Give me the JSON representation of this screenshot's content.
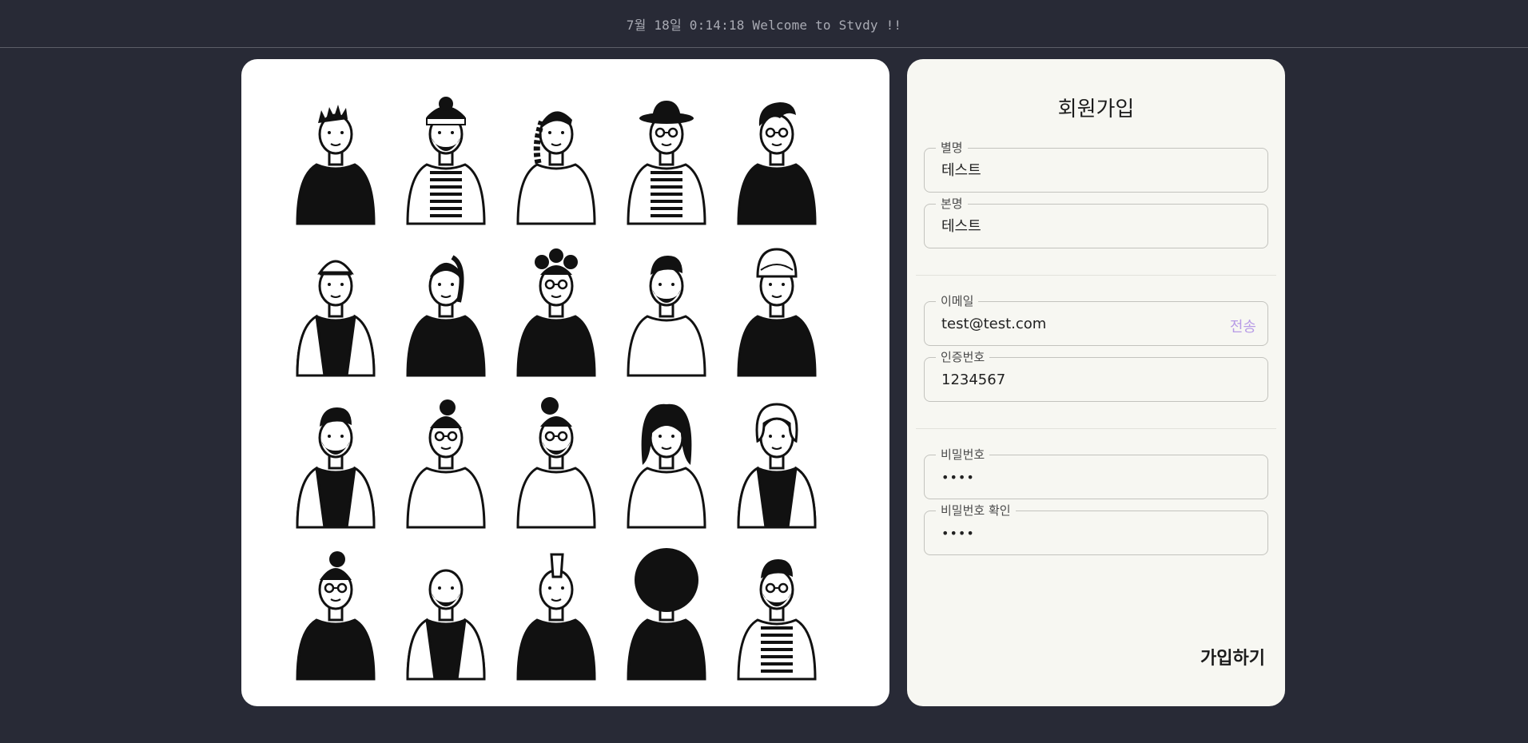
{
  "header": {
    "ticker": "7월 18일 0:14:18 Welcome to Stvdy !!"
  },
  "gallery": {
    "people": [
      {
        "name": "person-spiky-hair-pocket-tee",
        "dark_shirt": true,
        "hair": "spiky"
      },
      {
        "name": "person-bandana-beard-striped",
        "dark_shirt": false,
        "hair": "bandana",
        "beard": true,
        "stripes": true
      },
      {
        "name": "person-braid-tee",
        "dark_shirt": false,
        "hair": "braid"
      },
      {
        "name": "person-hat-glasses-blazer",
        "dark_shirt": false,
        "hair": "hat",
        "glasses": true,
        "stripes": true
      },
      {
        "name": "person-quiff-pocket-tee",
        "dark_shirt": true,
        "hair": "quiff",
        "glasses": true
      },
      {
        "name": "person-beanie-blazer",
        "dark_shirt": true,
        "hair": "beanie",
        "jacket": true
      },
      {
        "name": "person-ponytail-dark-tee",
        "dark_shirt": true,
        "hair": "ponytail"
      },
      {
        "name": "person-buns-glasses-arms-crossed",
        "dark_shirt": true,
        "hair": "buns",
        "glasses": true
      },
      {
        "name": "person-beard-coffee-cup",
        "dark_shirt": false,
        "hair": "short",
        "beard": true
      },
      {
        "name": "person-turban-dotted-sweater",
        "dark_shirt": true,
        "hair": "turban"
      },
      {
        "name": "person-beard-puffer-jacket",
        "dark_shirt": true,
        "hair": "short",
        "beard": true,
        "jacket": true
      },
      {
        "name": "person-sunglasses-gamepad-hoodie",
        "dark_shirt": false,
        "hair": "bun",
        "glasses": true
      },
      {
        "name": "person-topknot-glasses-beard",
        "dark_shirt": false,
        "hair": "topknot",
        "glasses": true,
        "beard": true
      },
      {
        "name": "person-long-hair-shirt",
        "dark_shirt": false,
        "hair": "long"
      },
      {
        "name": "person-curly-mustache-cardigan",
        "dark_shirt": true,
        "hair": "curly",
        "jacket": true
      },
      {
        "name": "person-bun-monocle-pointing",
        "dark_shirt": true,
        "hair": "bun",
        "glasses": true
      },
      {
        "name": "person-bald-beard-dotted-jacket",
        "dark_shirt": true,
        "hair": "bald",
        "beard": true,
        "jacket": true
      },
      {
        "name": "person-mohawk-tee",
        "dark_shirt": true,
        "hair": "mohawk"
      },
      {
        "name": "person-afro-glasses-pointing",
        "dark_shirt": true,
        "hair": "afro",
        "glasses": true
      },
      {
        "name": "person-glasses-beard-blazer",
        "dark_shirt": false,
        "hair": "short",
        "glasses": true,
        "beard": true,
        "stripes": true
      }
    ]
  },
  "signup": {
    "title": "회원가입",
    "nickname": {
      "label": "별명",
      "value": "테스트"
    },
    "realname": {
      "label": "본명",
      "value": "테스트"
    },
    "email": {
      "label": "이메일",
      "value": "test@test.com",
      "send_label": "전송"
    },
    "code": {
      "label": "인증번호",
      "value": "1234567"
    },
    "password": {
      "label": "비밀번호",
      "value": "••••"
    },
    "password_confirm": {
      "label": "비밀번호 확인",
      "value": "••••"
    },
    "submit_label": "가입하기"
  },
  "colors": {
    "background": "#282a36",
    "card": "#f7f7f2",
    "accent": "#b79be6"
  }
}
